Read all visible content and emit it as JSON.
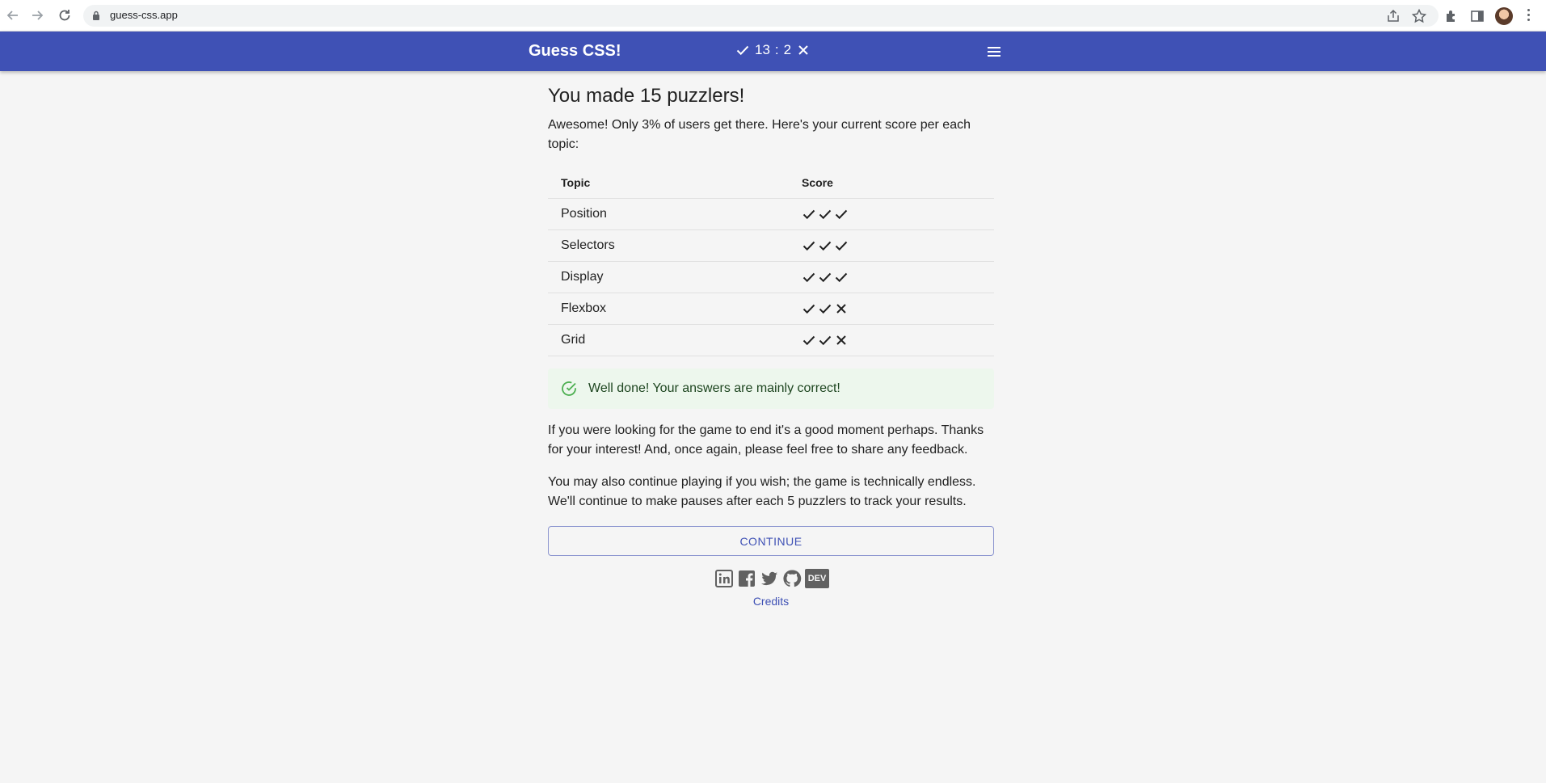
{
  "browser": {
    "url": "guess-css.app",
    "icons": [
      "back-icon",
      "forward-icon",
      "reload-icon",
      "lock-icon",
      "share-icon",
      "star-icon",
      "extensions-icon",
      "side-panel-icon",
      "profile-avatar",
      "kebab-menu-icon"
    ]
  },
  "appbar": {
    "title": "Guess CSS!",
    "correct_count": "13",
    "separator": ":",
    "wrong_count": "2",
    "menu_icon": "hamburger-menu-icon"
  },
  "main": {
    "heading": "You made 15 puzzlers!",
    "intro": "Awesome! Only 3% of users get there. Here's your current score per each topic:",
    "table": {
      "headers": [
        "Topic",
        "Score"
      ],
      "rows": [
        {
          "topic": "Position",
          "marks": [
            "check",
            "check",
            "check"
          ]
        },
        {
          "topic": "Selectors",
          "marks": [
            "check",
            "check",
            "check"
          ]
        },
        {
          "topic": "Display",
          "marks": [
            "check",
            "check",
            "check"
          ]
        },
        {
          "topic": "Flexbox",
          "marks": [
            "check",
            "check",
            "cross"
          ]
        },
        {
          "topic": "Grid",
          "marks": [
            "check",
            "check",
            "cross"
          ]
        }
      ]
    },
    "alert": {
      "text": "Well done! Your answers are mainly correct!",
      "icon": "check-circle-icon",
      "color": "#4caf50"
    },
    "paragraph1": "If you were looking for the game to end it's a good moment perhaps. Thanks for your interest! And, once again, please feel free to share any feedback.",
    "paragraph2": "You may also continue playing if you wish; the game is technically endless. We'll continue to make pauses after each 5 puzzlers to track your results.",
    "continue_label": "Continue"
  },
  "footer": {
    "social": [
      "linkedin-icon",
      "facebook-icon",
      "twitter-icon",
      "github-icon",
      "dev-icon"
    ],
    "dev_label": "DEV",
    "credits_label": "Credits"
  },
  "colors": {
    "primary": "#3f51b5",
    "background": "#f5f5f5",
    "success_bg": "#edf7ed"
  }
}
